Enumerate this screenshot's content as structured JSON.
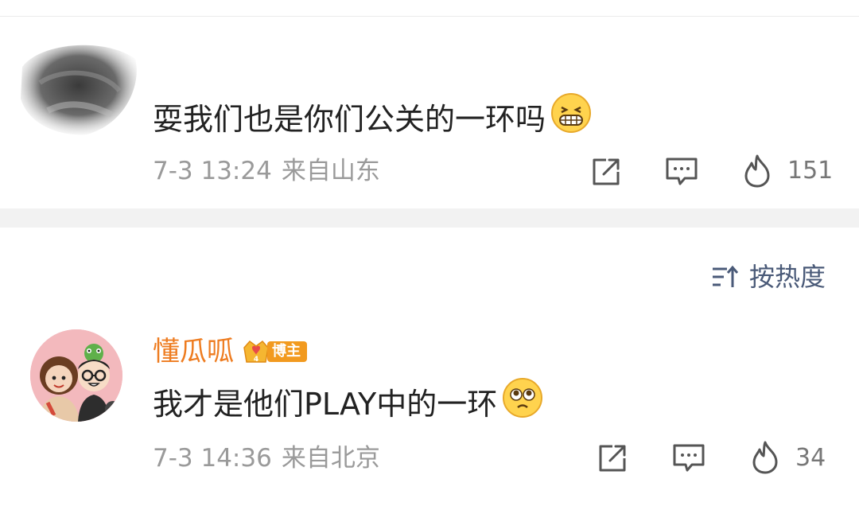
{
  "comments": [
    {
      "text": "耍我们也是你们公关的一环吗",
      "emoji": "grinning-face-emoji",
      "time": "7-3 13:24",
      "location": "来自山东",
      "likes": "151"
    },
    {
      "username": "懂瓜呱",
      "badge_label": "博主",
      "badge_level": "4",
      "text": "我才是他们PLAY中的一环",
      "emoji": "pleading-face-emoji",
      "time": "7-3 14:36",
      "location": "来自北京",
      "likes": "34"
    }
  ],
  "sort": {
    "label": "按热度",
    "icon": "sort-icon"
  },
  "icons": {
    "share": "share-icon",
    "reply": "comment-icon",
    "like": "fire-like-icon"
  },
  "colors": {
    "username": "#ee7c20",
    "meta": "#9a9a9a",
    "sort": "#4a5a78",
    "badge": "#f29a1f",
    "separator": "#f2f2f2"
  }
}
